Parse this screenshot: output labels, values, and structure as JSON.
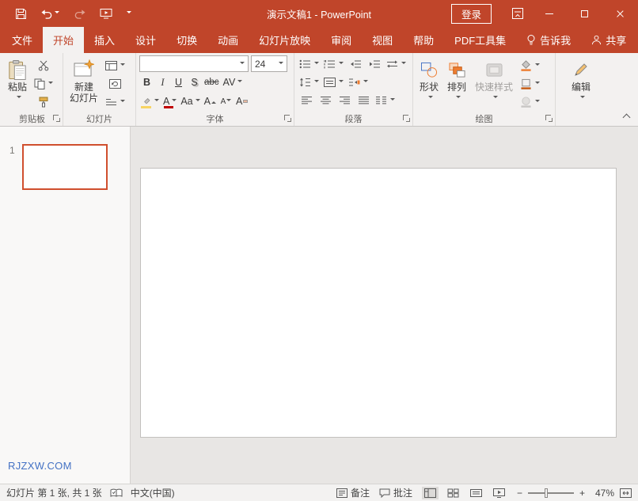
{
  "colors": {
    "accent": "#C0452A",
    "ribbon_bg": "#F3F1F0",
    "canvas_bg": "#E8E6E4",
    "statusbar_bg": "#F3F2F1",
    "selected_slide_border": "#D04F2E",
    "watermark_blue": "#4472C4"
  },
  "titlebar": {
    "title": "演示文稿1 - PowerPoint",
    "sign_in": "登录"
  },
  "tabs": {
    "file": "文件",
    "home": "开始",
    "insert": "插入",
    "design": "设计",
    "transitions": "切换",
    "animations": "动画",
    "slide_show": "幻灯片放映",
    "review": "审阅",
    "view": "视图",
    "help": "帮助",
    "pdf_tools": "PDF工具集",
    "tell_me": "告诉我",
    "share": "共享"
  },
  "ribbon": {
    "clipboard": {
      "label": "剪贴板",
      "paste": "粘贴"
    },
    "slides": {
      "label": "幻灯片",
      "new_slide_line1": "新建",
      "new_slide_line2": "幻灯片"
    },
    "font": {
      "label": "字体",
      "name_value": "",
      "size_value": "24",
      "bold": "B",
      "italic": "I",
      "underline": "U",
      "shadow": "S",
      "strikethrough": "abc",
      "char_spacing": "AV",
      "change_case": "Aa",
      "font_color": "A",
      "grow_font": "A",
      "shrink_font": "A",
      "clear_format": "A"
    },
    "paragraph": {
      "label": "段落"
    },
    "drawing": {
      "label": "绘图",
      "shapes": "形状",
      "arrange": "排列",
      "quick_styles": "快速样式"
    },
    "editing": {
      "label": "编辑"
    }
  },
  "slides_panel": {
    "slide_number": "1",
    "watermark": "RJZXW.COM"
  },
  "statusbar": {
    "slide_info": "幻灯片 第 1 张, 共 1 张",
    "language": "中文(中国)",
    "notes": "备注",
    "comments": "批注",
    "zoom_out": "−",
    "zoom_in": "+",
    "zoom_level": "47%"
  }
}
